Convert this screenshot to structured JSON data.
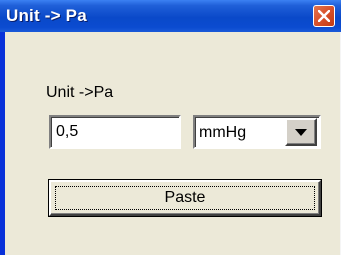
{
  "window": {
    "title": "Unit -> Pa",
    "close_icon": "close-icon"
  },
  "form": {
    "label": "Unit ->Pa",
    "value": "0,5",
    "unit_selected": "mmHg",
    "dropdown_icon": "chevron-down-icon",
    "paste_label": "Paste"
  },
  "colors": {
    "titlebar": "#0a49c9",
    "window_bg": "#ece9d8",
    "close_button": "#d8512b"
  }
}
